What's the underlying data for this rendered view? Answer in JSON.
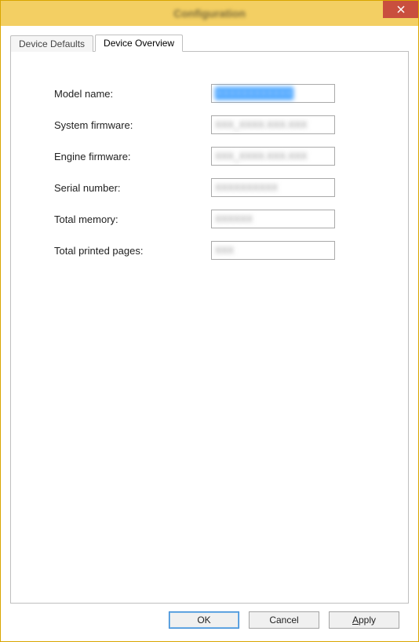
{
  "window": {
    "title": "Configuration"
  },
  "tabs": {
    "device_defaults": "Device Defaults",
    "device_overview": "Device Overview"
  },
  "fields": {
    "model_name": {
      "label": "Model name:",
      "value": "XXXXXXXXXXXX"
    },
    "sys_fw": {
      "label": "System firmware:",
      "value": "XXX_XXXX.XXX.XXX"
    },
    "eng_fw": {
      "label": "Engine firmware:",
      "value": "XXX_XXXX.XXX.XXX"
    },
    "serial": {
      "label": "Serial number:",
      "value": "XXXXXXXXXX"
    },
    "memory": {
      "label": "Total memory:",
      "value": "XXXXXX"
    },
    "pages": {
      "label": "Total printed pages:",
      "value": "XXX"
    }
  },
  "buttons": {
    "ok": "OK",
    "cancel": "Cancel",
    "apply_pre": "",
    "apply_ul": "A",
    "apply_post": "pply"
  }
}
